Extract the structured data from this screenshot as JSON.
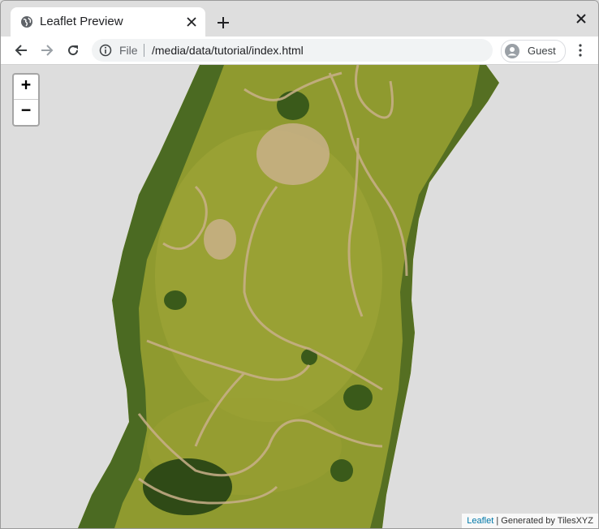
{
  "browser": {
    "tab": {
      "title": "Leaflet Preview",
      "favicon": "globe-icon"
    },
    "new_tab_icon": "plus-icon",
    "close_window_icon": "close-icon",
    "nav": {
      "back_icon": "arrow-left-icon",
      "forward_icon": "arrow-right-icon",
      "reload_icon": "reload-icon"
    },
    "omnibox": {
      "info_icon": "info-icon",
      "scheme_label": "File",
      "url": "/media/data/tutorial/index.html"
    },
    "profile": {
      "label": "Guest",
      "icon": "person-icon"
    },
    "menu_icon": "kebab-menu-icon"
  },
  "map": {
    "zoom_in": "+",
    "zoom_out": "−",
    "attribution": {
      "link_text": "Leaflet",
      "rest": " | Generated by TilesXYZ"
    },
    "colors": {
      "background": "#dddddd",
      "grass": "#8f9a2f",
      "trees": "#3f5a1e",
      "trail": "#c9b08a"
    }
  }
}
